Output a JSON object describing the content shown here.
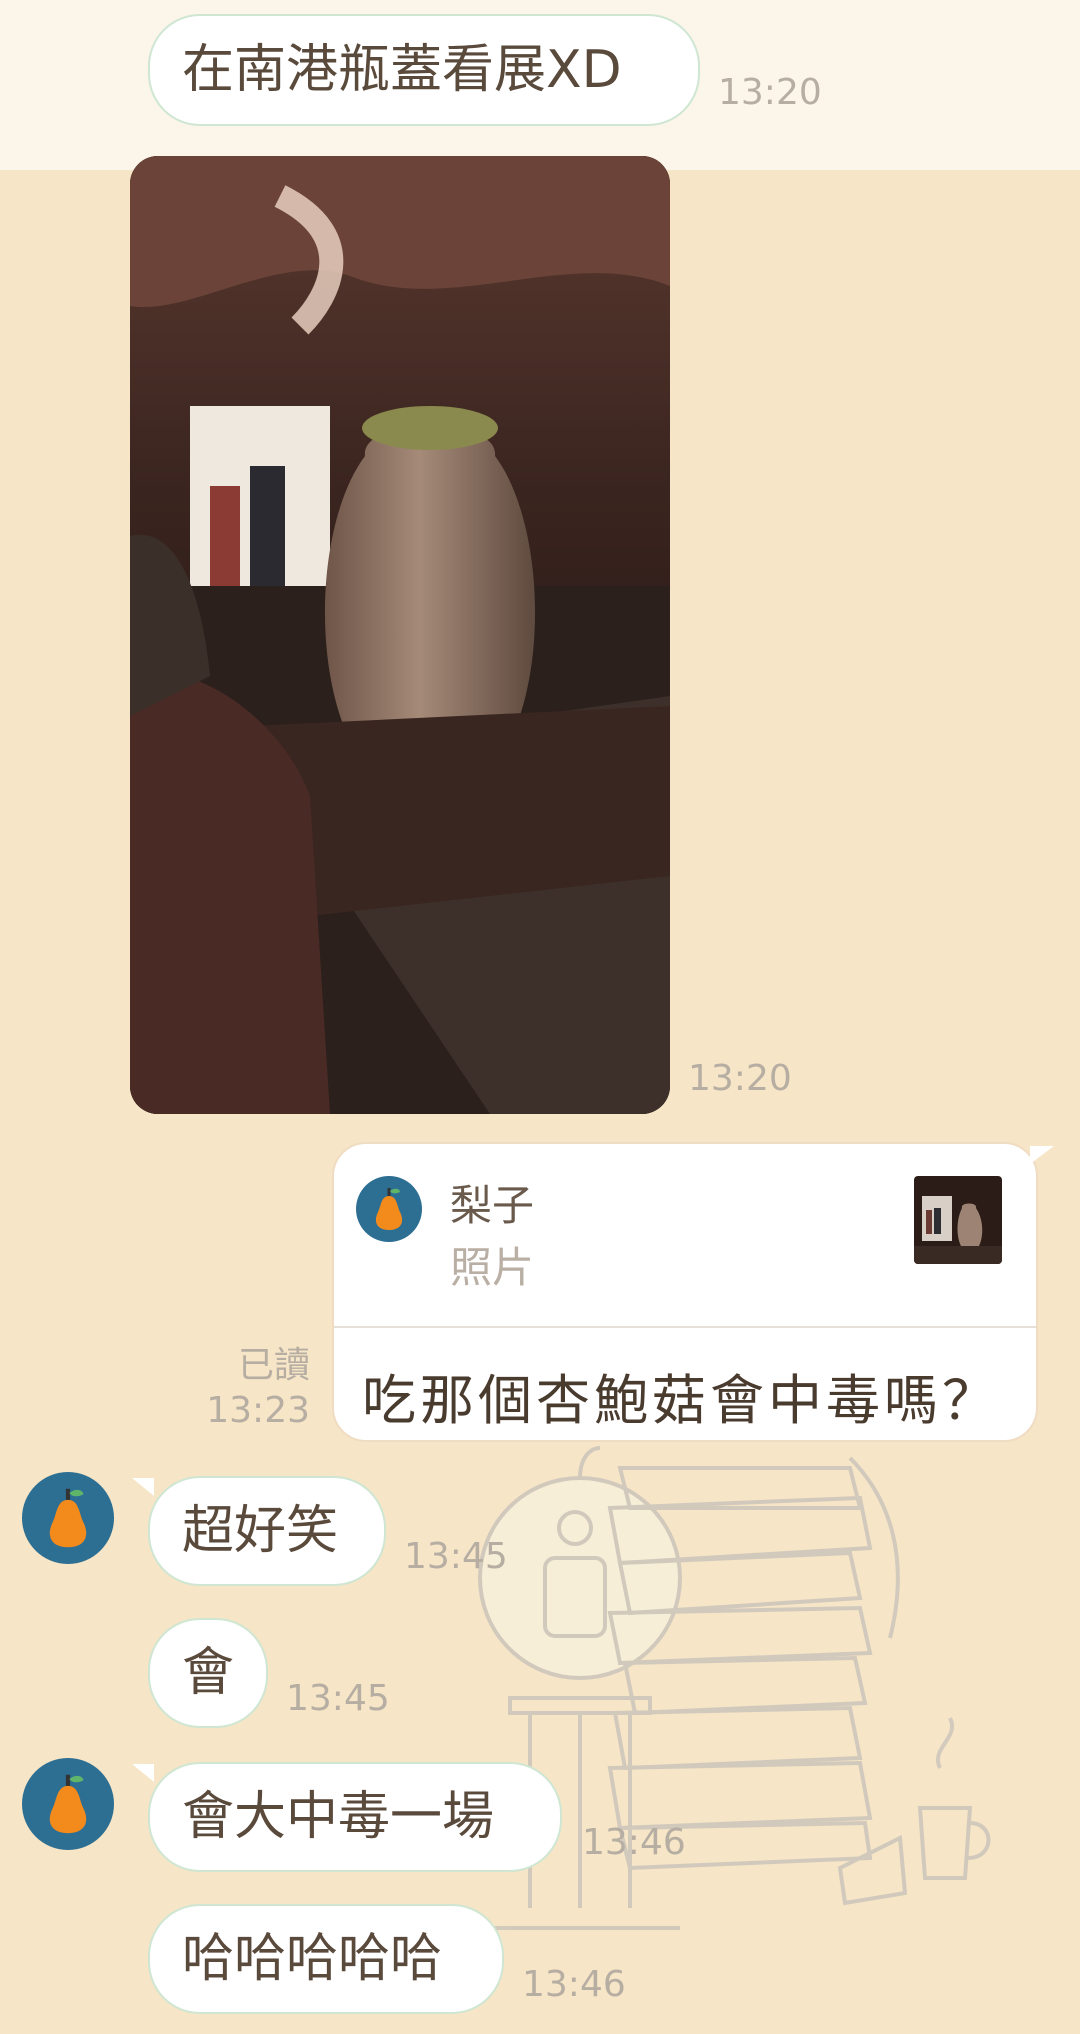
{
  "messages": [
    {
      "text": "在南港瓶蓋看展XD",
      "time": "13:20"
    },
    {
      "type": "photo",
      "time": "13:20"
    },
    {
      "reply": {
        "name": "梨子",
        "sub": "照片"
      },
      "text": "吃那個杏鮑菇會中毒嗎？",
      "read": "已讀",
      "time": "13:23"
    },
    {
      "text": "超好笑",
      "time": "13:45"
    },
    {
      "text": "會",
      "time": "13:45"
    },
    {
      "text": "會大中毒一場",
      "time": "13:46"
    },
    {
      "text": "哈哈哈哈哈",
      "time": "13:46"
    }
  ],
  "colors": {
    "chat_background": "#f6e5c6",
    "bubble_border": "#cfe6d2",
    "avatar_bg": "#2d6e93",
    "pear": "#f28a1c"
  },
  "icons": {
    "avatar": "pear-icon"
  }
}
